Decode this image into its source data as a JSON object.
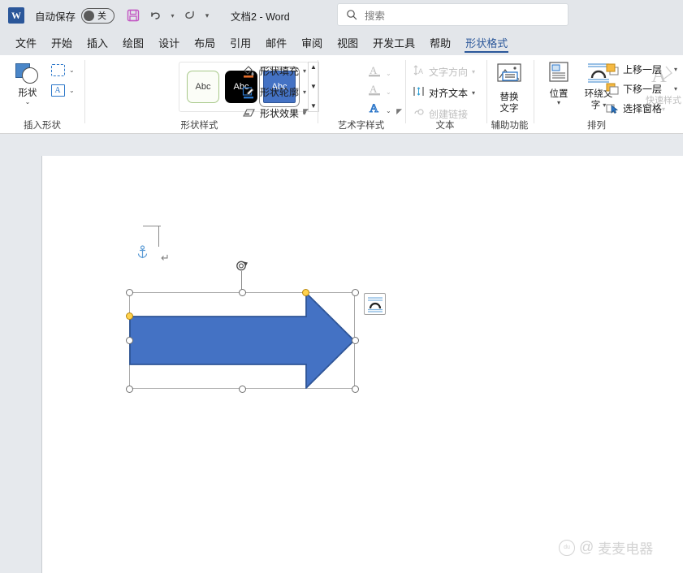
{
  "titlebar": {
    "app_logo": "word-logo",
    "autosave_label": "自动保存",
    "autosave_state": "关",
    "save_icon": "save-icon",
    "undo_icon": "undo-icon",
    "redo_icon": "redo-icon",
    "qat_more_icon": "chevron-down-icon",
    "document_title": "文档2  -  Word"
  },
  "search": {
    "icon": "search-icon",
    "placeholder": "搜索"
  },
  "tabs": [
    {
      "label": "文件",
      "active": false
    },
    {
      "label": "开始",
      "active": false
    },
    {
      "label": "插入",
      "active": false
    },
    {
      "label": "绘图",
      "active": false
    },
    {
      "label": "设计",
      "active": false
    },
    {
      "label": "布局",
      "active": false
    },
    {
      "label": "引用",
      "active": false
    },
    {
      "label": "邮件",
      "active": false
    },
    {
      "label": "审阅",
      "active": false
    },
    {
      "label": "视图",
      "active": false
    },
    {
      "label": "开发工具",
      "active": false
    },
    {
      "label": "帮助",
      "active": false
    },
    {
      "label": "形状格式",
      "active": true
    }
  ],
  "ribbon": {
    "groups": {
      "insert_shapes": {
        "label": "插入形状",
        "shapes_button": "形状",
        "shapes_icon": "shapes-icon",
        "edit_shape_icon": "edit-shape-icon",
        "text_box_icon": "text-box-icon"
      },
      "shape_styles": {
        "label": "形状样式",
        "gallery": [
          {
            "text": "Abc",
            "name": "style-light-green",
            "selected": false
          },
          {
            "text": "Abc",
            "name": "style-black",
            "selected": false
          },
          {
            "text": "Abc",
            "name": "style-blue",
            "selected": true
          }
        ],
        "scroll_up": "▲",
        "scroll_down": "▼",
        "scroll_more": "▼",
        "items": [
          {
            "label": "形状填充",
            "icon": "shape-fill-icon",
            "caret": "▾"
          },
          {
            "label": "形状轮廓",
            "icon": "shape-outline-icon",
            "caret": "▾"
          },
          {
            "label": "形状效果",
            "icon": "shape-effects-icon",
            "caret": "▾"
          }
        ],
        "dialog_launcher": "◤"
      },
      "wordart_styles": {
        "label": "艺术字样式",
        "quick_styles_label": "快速样式",
        "quick_styles_icon": "wordart-quick-styles-icon",
        "quick_styles_caret": "▾",
        "text_fill_icon": "text-fill-icon",
        "text_outline_icon": "text-outline-icon",
        "text_effects_icon": "text-effects-icon",
        "dialog_launcher": "◤"
      },
      "text": {
        "label": "文本",
        "items": [
          {
            "label": "文字方向",
            "icon": "text-direction-icon",
            "caret": "▾",
            "enabled": false
          },
          {
            "label": "对齐文本",
            "icon": "align-text-icon",
            "caret": "▾",
            "enabled": true
          },
          {
            "label": "创建链接",
            "icon": "create-link-icon",
            "caret": "",
            "enabled": false
          }
        ]
      },
      "accessibility": {
        "label": "辅助功能",
        "alt_text_label": "替换\n文字",
        "alt_text_line1": "替换",
        "alt_text_line2": "文字",
        "alt_text_icon": "alt-text-icon"
      },
      "arrange": {
        "label": "排列",
        "position_label": "位置",
        "position_icon": "position-icon",
        "position_caret": "▾",
        "wrap_text_line1": "环绕文",
        "wrap_text_line2": "字",
        "wrap_text_icon": "wrap-text-icon",
        "wrap_text_caret": "▾",
        "bring_forward": "上移一层",
        "bring_forward_icon": "bring-forward-icon",
        "bring_forward_caret": "▾",
        "send_backward": "下移一层",
        "send_backward_icon": "send-backward-icon",
        "send_backward_caret": "▾",
        "selection_pane": "选择窗格",
        "selection_pane_icon": "selection-pane-icon"
      }
    }
  },
  "document": {
    "anchor_icon": "anchor-icon",
    "paragraph_mark": "↵",
    "shape": {
      "name": "right-arrow-shape",
      "fill_color": "#4472c4",
      "outline_color": "#2f5597",
      "selected": true,
      "handles": 8,
      "adjust_handles": 2,
      "rotation_icon": "rotation-handle-icon"
    },
    "layout_options_icon": "layout-options-icon"
  },
  "watermark": {
    "paw": "du",
    "at": "@",
    "text": "麦麦电器"
  },
  "colors": {
    "accent": "#2b579a",
    "shape_fill": "#4472c4",
    "shape_outline": "#2f5597",
    "handle_yellow": "#ffd24d",
    "ribbon_bg": "#ffffff",
    "chrome_bg": "#e3e6ea",
    "canvas_bg": "#e6e9ed"
  }
}
